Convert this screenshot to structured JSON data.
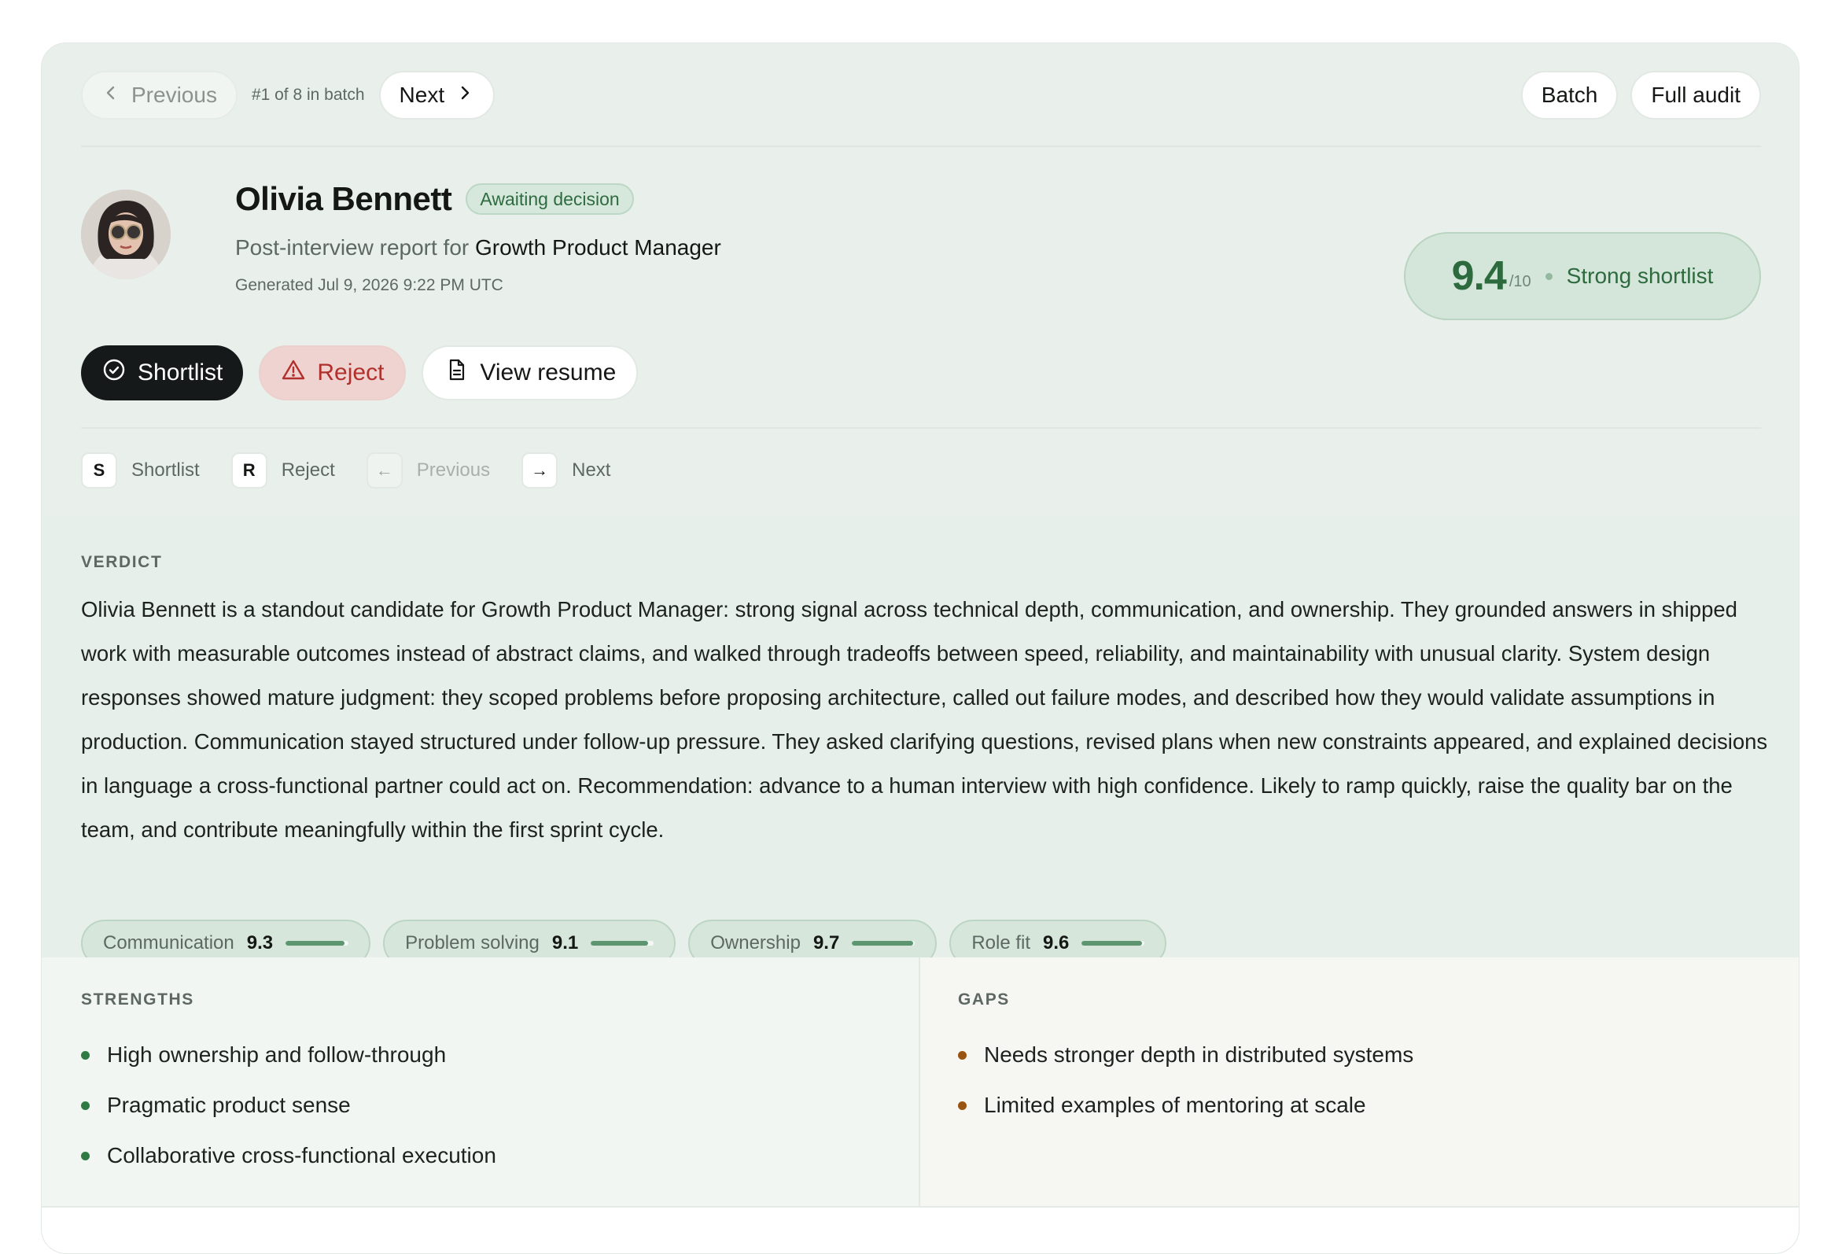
{
  "nav": {
    "previous_label": "Previous",
    "batch_position": "#1 of 8 in batch",
    "next_label": "Next",
    "batch_label": "Batch",
    "full_audit_label": "Full audit"
  },
  "candidate": {
    "name": "Olivia Bennett",
    "status": "Awaiting decision",
    "report_prefix": "Post-interview report for",
    "role": "Growth Product Manager",
    "generated": "Generated Jul 9, 2026 9:22 PM UTC"
  },
  "score": {
    "value": "9.4",
    "denominator": "/10",
    "label": "Strong shortlist"
  },
  "actions": {
    "shortlist": "Shortlist",
    "reject": "Reject",
    "view_resume": "View resume"
  },
  "shortcuts": [
    {
      "key": "S",
      "label": "Shortlist"
    },
    {
      "key": "R",
      "label": "Reject"
    },
    {
      "key": "←",
      "label": "Previous"
    },
    {
      "key": "→",
      "label": "Next"
    }
  ],
  "verdict": {
    "heading": "VERDICT",
    "text": "Olivia Bennett is a standout candidate for Growth Product Manager: strong signal across technical depth, communication, and ownership. They grounded answers in shipped work with measurable outcomes instead of abstract claims, and walked through tradeoffs between speed, reliability, and maintainability with unusual clarity. System design responses showed mature judgment: they scoped problems before proposing architecture, called out failure modes, and described how they would validate assumptions in production. Communication stayed structured under follow-up pressure. They asked clarifying questions, revised plans when new constraints appeared, and explained decisions in language a cross-functional partner could act on. Recommendation: advance to a human interview with high confidence. Likely to ramp quickly, raise the quality bar on the team, and contribute meaningfully within the first sprint cycle."
  },
  "metrics": [
    {
      "label": "Communication",
      "value": "9.3",
      "fraction": 0.93
    },
    {
      "label": "Problem solving",
      "value": "9.1",
      "fraction": 0.91
    },
    {
      "label": "Ownership",
      "value": "9.7",
      "fraction": 0.97
    },
    {
      "label": "Role fit",
      "value": "9.6",
      "fraction": 0.96
    }
  ],
  "strengths": {
    "heading": "STRENGTHS",
    "items": [
      "High ownership and follow-through",
      "Pragmatic product sense",
      "Collaborative cross-functional execution"
    ]
  },
  "gaps": {
    "heading": "GAPS",
    "items": [
      "Needs stronger depth in distributed systems",
      "Limited examples of mentoring at scale"
    ]
  },
  "colors": {
    "accent_green": "#2d6a3e",
    "reject_red": "#b2302c",
    "gap_bullet": "#9a5412"
  }
}
